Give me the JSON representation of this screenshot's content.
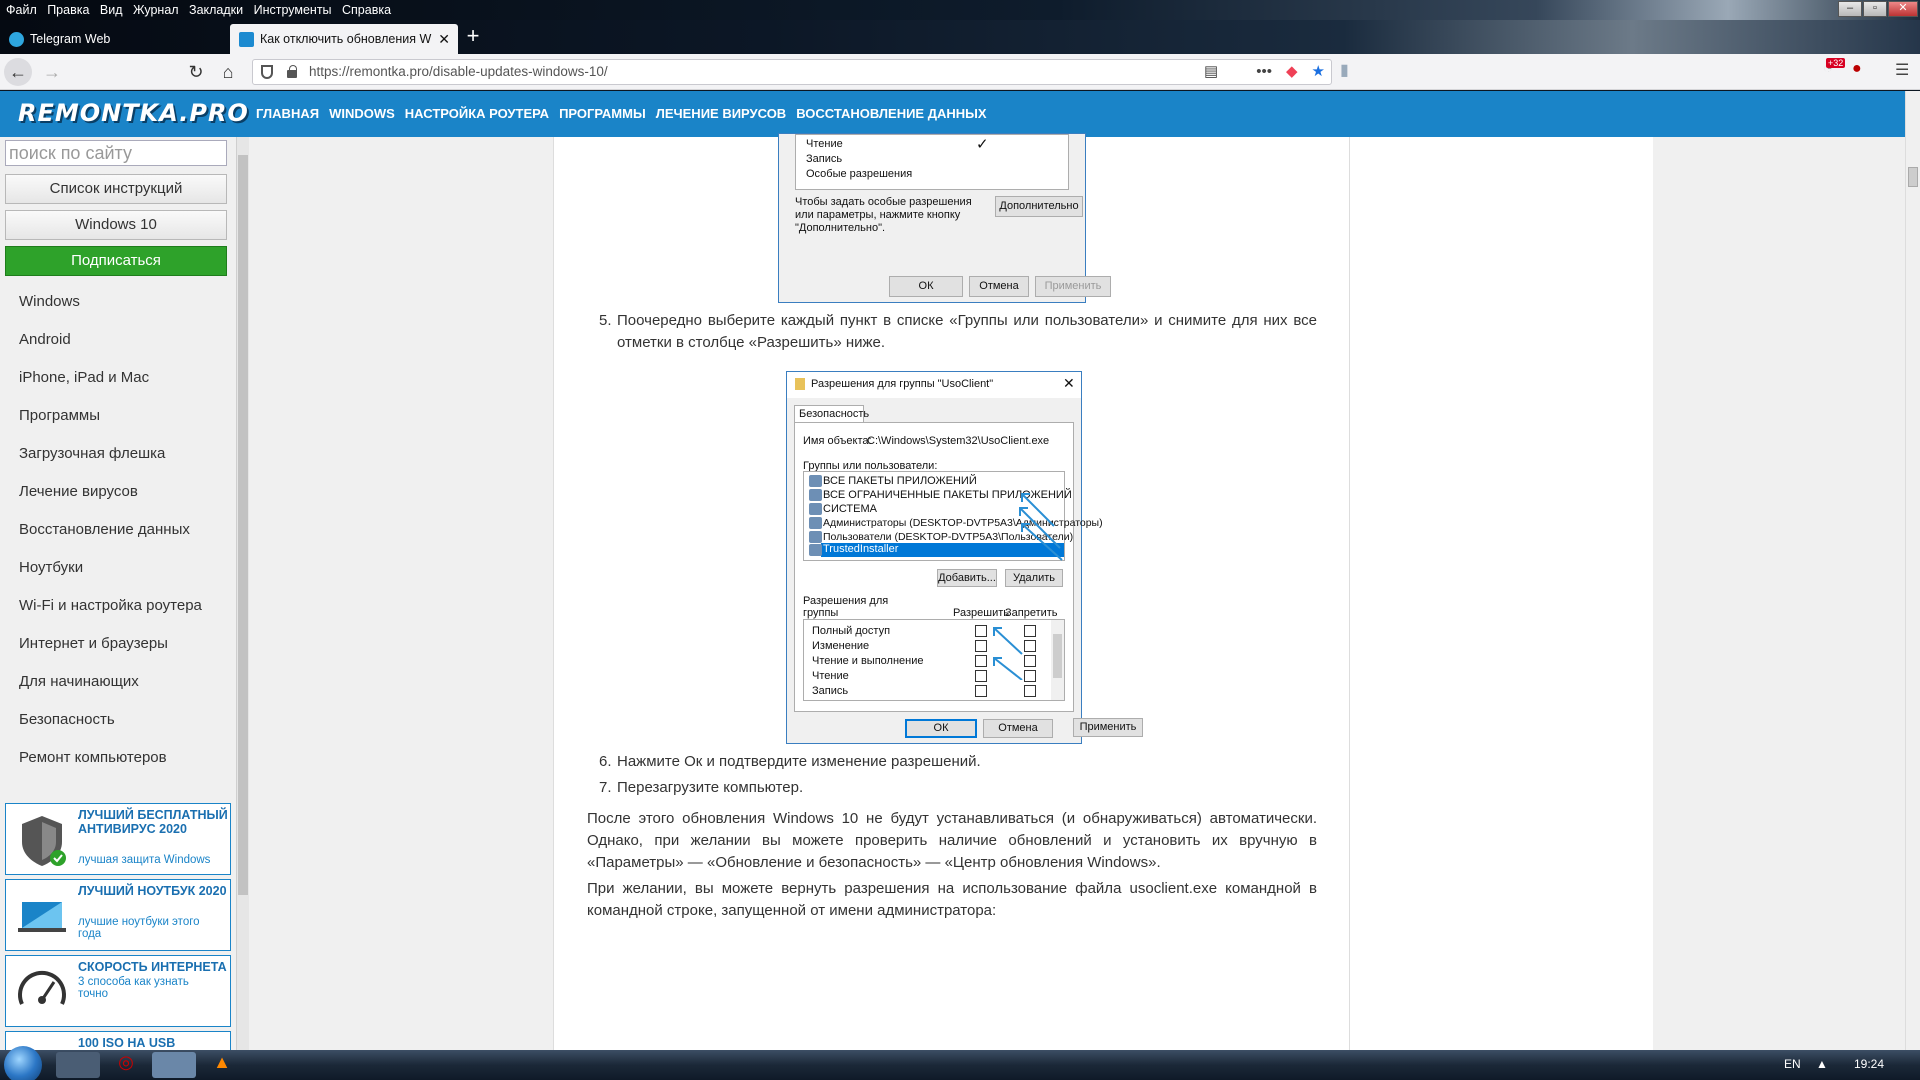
{
  "menubar": {
    "items": [
      "Файл",
      "Правка",
      "Вид",
      "Журнал",
      "Закладки",
      "Инструменты",
      "Справка"
    ]
  },
  "tabs": [
    {
      "label": "Telegram Web",
      "icon": "telegram-icon"
    },
    {
      "label": "Как отключить обновления W",
      "icon": "site-icon"
    }
  ],
  "address": {
    "url": "https://remontka.pro/disable-updates-windows-10/"
  },
  "toolbar": {
    "badge": "+32"
  },
  "site": {
    "logo": "REMONTKA.PRO",
    "nav": [
      "ГЛАВНАЯ",
      "WINDOWS",
      "НАСТРОЙКА РОУТЕРА",
      "ПРОГРАММЫ",
      "ЛЕЧЕНИЕ ВИРУСОВ",
      "ВОССТАНОВЛЕНИЕ ДАННЫХ"
    ]
  },
  "sidebar": {
    "search_placeholder": "поиск по сайту",
    "btn_list": "Список инструкций",
    "btn_win10": "Windows 10",
    "btn_subscribe": "Подписаться",
    "links": [
      "Windows",
      "Android",
      "iPhone, iPad и Mac",
      "Программы",
      "Загрузочная флешка",
      "Лечение вирусов",
      "Восстановление данных",
      "Ноутбуки",
      "Wi-Fi и настройка роутера",
      "Интернет и браузеры",
      "Для начинающих",
      "Безопасность",
      "Ремонт компьютеров"
    ],
    "promos": [
      {
        "title": "ЛУЧШИЙ БЕСПЛАТНЫЙ АНТИВИРУС 2020",
        "sub": "лучшая защита Windows"
      },
      {
        "title": "ЛУЧШИЙ НОУТБУК 2020",
        "sub": "лучшие ноутбуки этого года"
      },
      {
        "title": "СКОРОСТЬ ИНТЕРНЕТА",
        "sub": "3 способа как узнать точно"
      },
      {
        "title": "100 ISO НА USB",
        "sub": ""
      }
    ]
  },
  "dialog1": {
    "rows": [
      "Чтение",
      "Запись",
      "Особые разрешения"
    ],
    "hint": "Чтобы задать особые разрешения или параметры, нажмите кнопку \"Дополнительно\".",
    "btn_advanced": "Дополнительно",
    "ok": "ОК",
    "cancel": "Отмена",
    "apply": "Применить"
  },
  "step5": "Поочередно выберите каждый пункт в списке «Группы или пользователи» и снимите для них все отметки в столбце «Разрешить» ниже.",
  "dialog2": {
    "title": "Разрешения для группы \"UsoClient\"",
    "tab": "Безопасность",
    "object_label": "Имя объекта:",
    "object_value": "C:\\Windows\\System32\\UsoClient.exe",
    "groups_label": "Группы или пользователи:",
    "groups": [
      "ВСЕ ПАКЕТЫ ПРИЛОЖЕНИЙ",
      "ВСЕ ОГРАНИЧЕННЫЕ ПАКЕТЫ ПРИЛОЖЕНИЙ",
      "СИСТЕМА",
      "Администраторы (DESKTOP-DVTP5A3\\Администраторы)",
      "Пользователи (DESKTOP-DVTP5A3\\Пользователи)",
      "TrustedInstaller"
    ],
    "add": "Добавить...",
    "remove": "Удалить",
    "perm_label": "Разрешения для группы \"TrustedInstaller\"",
    "col_allow": "Разрешить",
    "col_deny": "Запретить",
    "perms": [
      "Полный доступ",
      "Изменение",
      "Чтение и выполнение",
      "Чтение",
      "Запись"
    ],
    "ok": "ОК",
    "cancel": "Отмена",
    "apply": "Применить"
  },
  "step6": "Нажмите Ок и подтвердите изменение разрешений.",
  "step7": "Перезагрузите компьютер.",
  "para1": "После этого обновления Windows 10 не будут устанавливаться (и обнаруживаться) автоматически. Однако, при желании вы можете проверить наличие обновлений и установить их вручную в «Параметры» — «Обновление и безопасность» — «Центр обновления Windows».",
  "para2": "При желании, вы можете вернуть разрешения на использование файла usoclient.exe командной в командной строке, запущенной от имени администратора:",
  "taskbar": {
    "lang": "EN",
    "time": "19:24"
  },
  "colors": {
    "brand": "#1a84c8",
    "subscribe": "#2ea22a",
    "selection": "#0078d7"
  }
}
